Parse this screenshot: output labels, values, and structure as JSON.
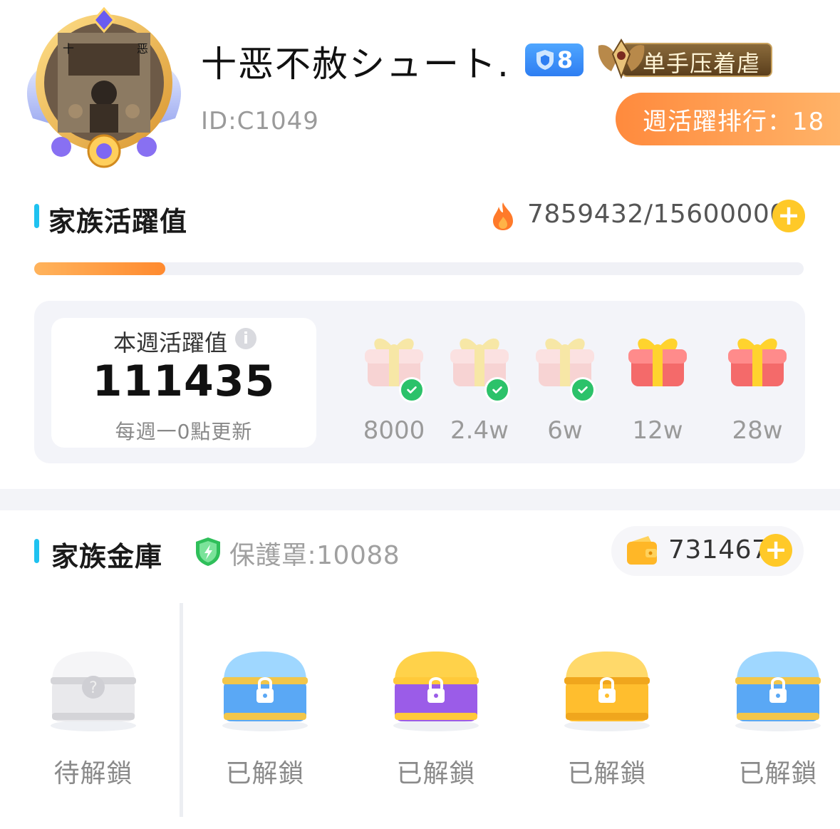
{
  "profile": {
    "name": "十恶不赦シュート.",
    "id_text": "ID:C1049",
    "level": "8",
    "title_badge": "单手压着虐",
    "weekly_rank": "週活躍排行：18",
    "avatar_glyph_left": "十",
    "avatar_glyph_right": "恶"
  },
  "family_activity": {
    "title": "家族活躍值",
    "count_text": "7859432/15600000",
    "progress": 0.17,
    "weekly_label": "本週活躍值",
    "weekly_value": "111435",
    "weekly_note": "每週一0點更新",
    "milestones": [
      {
        "label": "8000",
        "claimed": true
      },
      {
        "label": "2.4w",
        "claimed": true
      },
      {
        "label": "6w",
        "claimed": true
      },
      {
        "label": "12w",
        "claimed": false
      },
      {
        "label": "28w",
        "claimed": false
      }
    ]
  },
  "treasury": {
    "title": "家族金庫",
    "protection": "保護罩:10088",
    "coins": "731467",
    "chests": [
      {
        "label": "待解鎖",
        "style": "locked-gray"
      },
      {
        "label": "已解鎖",
        "style": "blue"
      },
      {
        "label": "已解鎖",
        "style": "purple-gold"
      },
      {
        "label": "已解鎖",
        "style": "gold"
      },
      {
        "label": "已解鎖",
        "style": "blue"
      }
    ]
  },
  "colors": {
    "accent_cyan": "#1fc2f0",
    "orange": "#ff8a2f",
    "gold": "#ffc928",
    "check_green": "#2cc26a"
  }
}
